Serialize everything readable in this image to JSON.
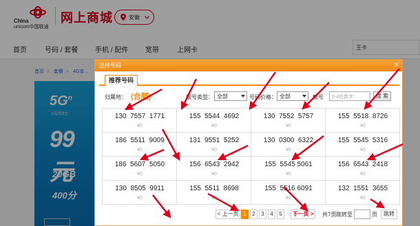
{
  "header": {
    "logo_text_line1": "China",
    "logo_text_line2": "unicom中国联通",
    "shop_title": "网上商城",
    "region": "安徽"
  },
  "nav": {
    "items": [
      "首页",
      "号码 / 套餐",
      "手机 / 配件",
      "宽带",
      "上网卡"
    ],
    "search_value": "王卡"
  },
  "background": {
    "breadcrumb": [
      "首页",
      "套餐",
      "4G本..."
    ],
    "promo": {
      "badge": "5G",
      "badge_sup": "n",
      "subtitle": "以及再发生",
      "price": "99元",
      "data": "20GB",
      "minutes": "400分"
    }
  },
  "modal": {
    "title": "选择号码",
    "close": "×",
    "tab": "推荐号码",
    "filters": {
      "location_label": "归属地：",
      "location_value": "(合肥)",
      "type_label": "靓号类型：",
      "type_value": "全部",
      "price_label": "号码价格：",
      "price_value": "全部",
      "number_label": "靓号",
      "number_placeholder": "2-4位数字",
      "search_button": "搜 索"
    },
    "numbers": [
      [
        "130  7557  1771",
        "155  5544  4692",
        "130  7552  5757",
        "155  5518  8726"
      ],
      [
        "186  5511  9009",
        "131  9551  5252",
        "130  0300  6322",
        "155  5545  5316"
      ],
      [
        "186  5607  5050",
        "156  6543  2942",
        "155  5545 5061",
        "156  6543  2418"
      ],
      [
        "130  8505  9911",
        "155  5511  8698",
        "155  5516 6091",
        "132  1551  3655"
      ]
    ],
    "price": "¥0",
    "pager": {
      "prev": "< 上一页",
      "pages": [
        "1",
        "2",
        "3",
        "4",
        "5"
      ],
      "active": "1",
      "next": "下一页 >",
      "total": "共7页",
      "goto_label": "跳转至",
      "page_unit": "页",
      "goto_button": "跳转"
    }
  },
  "colors": {
    "brand_red": "#d9001b",
    "accent_orange": "#f08a10",
    "arrow_red": "#e0001a"
  }
}
